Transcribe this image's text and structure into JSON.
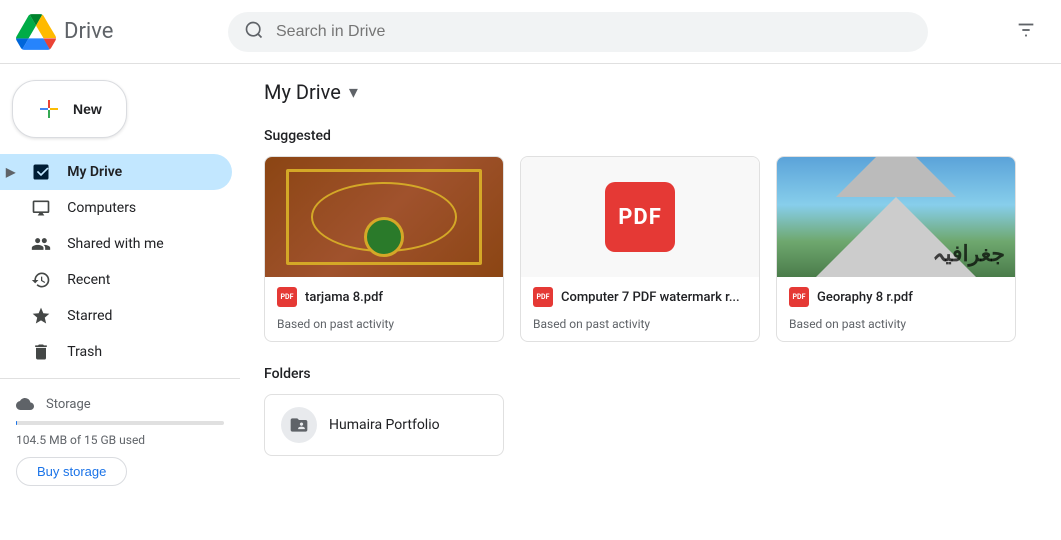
{
  "app": {
    "title": "Drive",
    "logo_alt": "Google Drive"
  },
  "header": {
    "search_placeholder": "Search in Drive",
    "search_value": "",
    "settings_icon": "settings-sliders-icon"
  },
  "sidebar": {
    "new_button_label": "New",
    "items": [
      {
        "id": "my-drive",
        "label": "My Drive",
        "icon": "drive-icon",
        "active": true
      },
      {
        "id": "computers",
        "label": "Computers",
        "icon": "computer-icon",
        "active": false
      },
      {
        "id": "shared-with-me",
        "label": "Shared with me",
        "icon": "people-icon",
        "active": false
      },
      {
        "id": "recent",
        "label": "Recent",
        "icon": "clock-icon",
        "active": false
      },
      {
        "id": "starred",
        "label": "Starred",
        "icon": "star-icon",
        "active": false
      },
      {
        "id": "trash",
        "label": "Trash",
        "icon": "trash-icon",
        "active": false
      }
    ],
    "storage": {
      "icon": "cloud-icon",
      "label": "Storage",
      "used_text": "104.5 MB of 15 GB used",
      "used_percent": 0.7,
      "buy_button_label": "Buy storage"
    }
  },
  "content": {
    "breadcrumb_title": "My Drive",
    "chevron": "▾",
    "suggested_label": "Suggested",
    "folders_label": "Folders",
    "suggested_files": [
      {
        "id": "tarjama",
        "name": "tarjama 8.pdf",
        "sub": "Based on past activity",
        "thumb_type": "tarjama",
        "badge": "PDF"
      },
      {
        "id": "computer7",
        "name": "Computer 7 PDF watermark r...",
        "sub": "Based on past activity",
        "thumb_type": "pdf",
        "badge": "PDF"
      },
      {
        "id": "georaphy",
        "name": "Georaphy 8 r.pdf",
        "sub": "Based on past activity",
        "thumb_type": "geo",
        "badge": "PDF"
      }
    ],
    "folders": [
      {
        "id": "humaira",
        "name": "Humaira Portfolio",
        "icon": "folder-shared-icon"
      }
    ]
  }
}
